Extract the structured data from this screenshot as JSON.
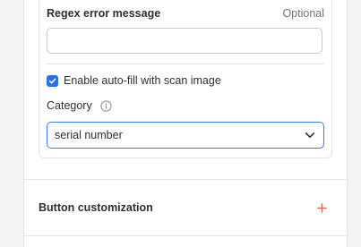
{
  "regex_field": {
    "label": "Regex error message",
    "optional_tag": "Optional",
    "value": "",
    "placeholder": ""
  },
  "autofill": {
    "checked": true,
    "label": "Enable auto-fill with scan image"
  },
  "category": {
    "label": "Category",
    "selected": "serial number"
  },
  "sections": {
    "button_customization": "Button customization"
  },
  "colors": {
    "accent": "#2f6fe4",
    "focus_border": "#3b7ddd",
    "add_icon": "#e06b3f"
  },
  "icons": {
    "checkbox": "check-icon",
    "category_info": "info-icon",
    "select_caret": "chevron-down-icon",
    "section_add": "plus-icon"
  }
}
